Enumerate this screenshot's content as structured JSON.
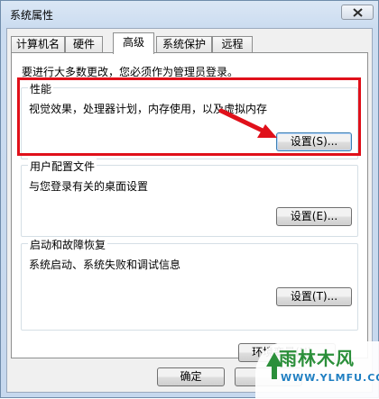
{
  "window": {
    "title": "系统属性"
  },
  "tabs": [
    {
      "label": "计算机名",
      "active": false
    },
    {
      "label": "硬件",
      "active": false
    },
    {
      "label": "高级",
      "active": true
    },
    {
      "label": "系统保护",
      "active": false
    },
    {
      "label": "远程",
      "active": false
    }
  ],
  "panel": {
    "notice": "要进行大多数更改，您必须作为管理员登录。",
    "groups": [
      {
        "title": "性能",
        "desc": "视觉效果，处理器计划，内存使用，以及虚拟内存",
        "button": "设置(S)..."
      },
      {
        "title": "用户配置文件",
        "desc": "与您登录有关的桌面设置",
        "button": "设置(E)..."
      },
      {
        "title": "启动和故障恢复",
        "desc": "系统启动、系统失败和调试信息",
        "button": "设置(T)..."
      }
    ],
    "env_button": "环境变量(N)..."
  },
  "footer": {
    "ok_label": "确定"
  },
  "watermark": {
    "text": "雨林木风",
    "url": "WWW.YLMFU.COM"
  },
  "colors": {
    "highlight": "#e0101a",
    "title_bg": "#cbdcf0",
    "watermark_green": "#2b8f3a"
  }
}
